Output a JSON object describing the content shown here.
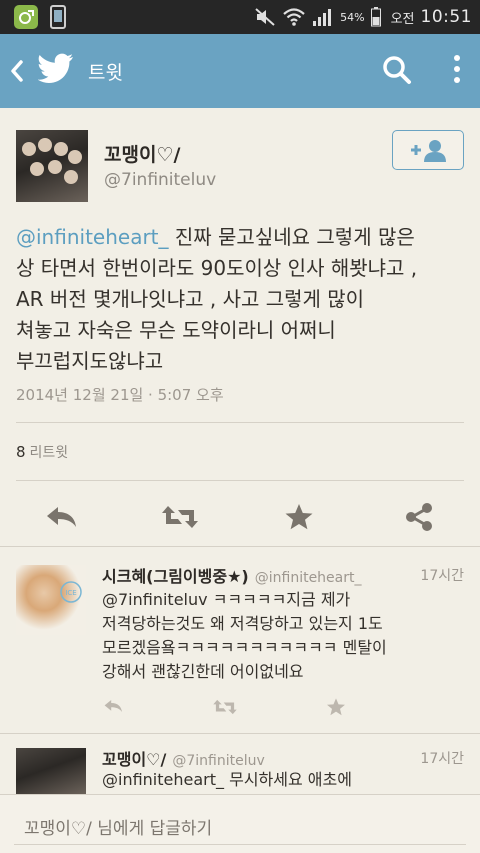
{
  "status_bar": {
    "battery": "54",
    "battery_unit": "%",
    "ampm": "오전",
    "time": "10:51"
  },
  "action_bar": {
    "title": "트윗"
  },
  "tweet": {
    "author_name": "꼬맹이♡/",
    "author_handle": "@7infiniteluv",
    "mention": "@infiniteheart_",
    "line1": " 진짜 묻고싶네요 그렇게 많은",
    "line2": "상 타면서 한번이라도 90도이상 인사 해봣냐고 ,",
    "line3": "AR 버전 몇개나잇냐고 , 사고 그렇게 많이",
    "line4": "쳐놓고 자숙은 무슨 도약이라니 어쩌니",
    "line5": "부끄럽지도않냐고",
    "timestamp": "2014년 12월 21일 · 5:07 오후",
    "retweet_count": "8",
    "retweet_label": "리트윗"
  },
  "replies": [
    {
      "name": "시크혜(그림이벵중★)",
      "handle": "@infiniteheart_",
      "time": "17시간",
      "lines": [
        "@7infiniteluv ㅋㅋㅋㅋㅋ지금 제가",
        "저격당하는것도 왜 저격당하고 있는지 1도",
        "모르겠음욬ㅋㅋㅋㅋㅋㅋㅋㅋㅋㅋㅋ 멘탈이",
        "강해서 괜찮긴한데 어이없네요"
      ]
    },
    {
      "name": "꼬맹이♡/",
      "handle": "@7infiniteluv",
      "time": "17시간",
      "lines": [
        "@infiniteheart_ 무시하세요 애초에"
      ]
    }
  ],
  "reply_bar": {
    "placeholder": "꼬맹이♡/ 님에게 답글하기"
  },
  "colors": {
    "accent": "#6aa3c2",
    "mention": "#5c9ec0",
    "background": "#f2efe6"
  }
}
